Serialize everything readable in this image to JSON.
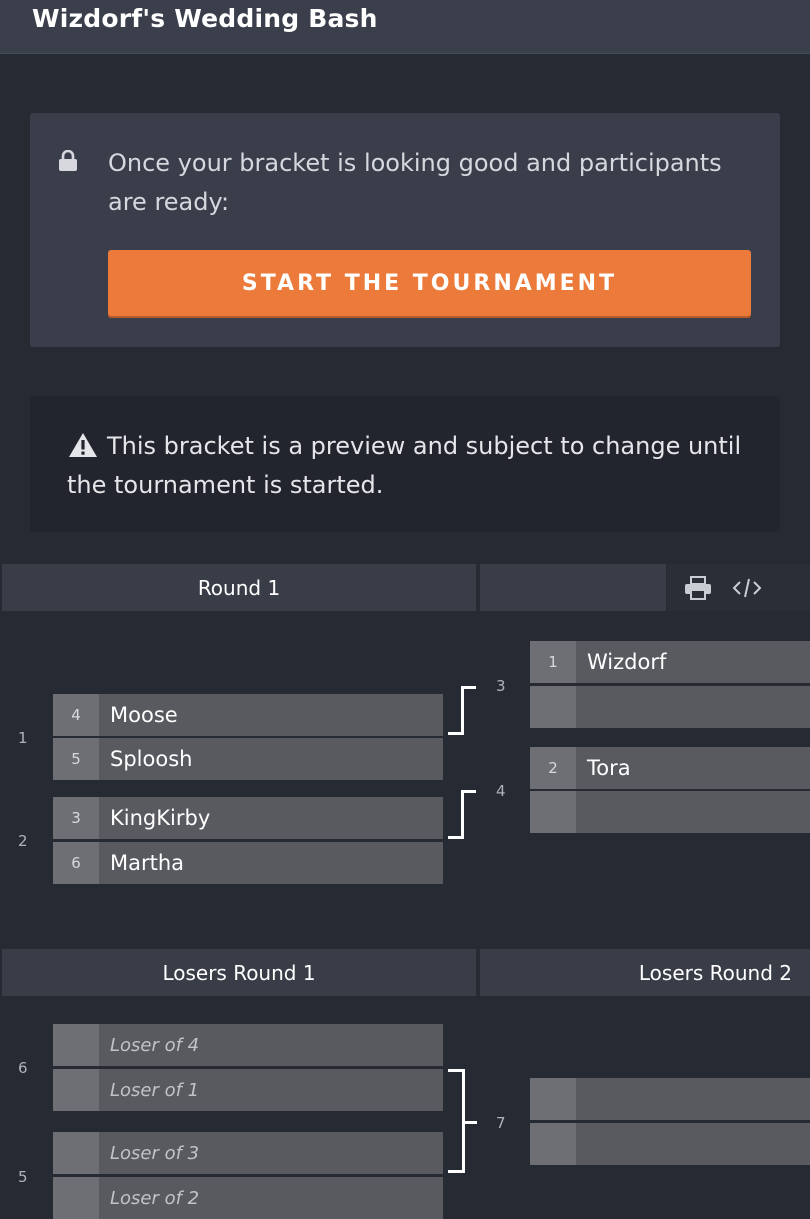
{
  "header": {
    "title": "Wizdorf's Wedding Bash"
  },
  "start_panel": {
    "message": "Once your bracket is looking good and participants are ready:",
    "button_label": "START THE TOURNAMENT",
    "lock_icon": "lock-icon",
    "button_color": "#ec7b3b"
  },
  "warning": {
    "message": "This bracket is a preview and subject to change until the tournament is started.",
    "icon": "warning-icon"
  },
  "winners_bracket": {
    "round1_label": "Round 1",
    "tools": {
      "print_icon": "print-icon",
      "embed_icon": "code-icon"
    },
    "matches": [
      {
        "number": "1",
        "slots": [
          {
            "seed": "4",
            "name": "Moose"
          },
          {
            "seed": "5",
            "name": "Sploosh"
          }
        ]
      },
      {
        "number": "2",
        "slots": [
          {
            "seed": "3",
            "name": "KingKirby"
          },
          {
            "seed": "6",
            "name": "Martha"
          }
        ]
      },
      {
        "number": "3",
        "slots": [
          {
            "seed": "1",
            "name": "Wizdorf"
          },
          {
            "seed": "",
            "name": ""
          }
        ]
      },
      {
        "number": "4",
        "slots": [
          {
            "seed": "2",
            "name": "Tora"
          },
          {
            "seed": "",
            "name": ""
          }
        ]
      }
    ]
  },
  "losers_bracket": {
    "round1_label": "Losers Round 1",
    "round2_label": "Losers Round 2",
    "matches": [
      {
        "number": "6",
        "slots": [
          {
            "seed": "",
            "name": "Loser of 4"
          },
          {
            "seed": "",
            "name": "Loser of 1"
          }
        ]
      },
      {
        "number": "5",
        "slots": [
          {
            "seed": "",
            "name": "Loser of 3"
          },
          {
            "seed": "",
            "name": "Loser of 2"
          }
        ]
      },
      {
        "number": "7",
        "slots": [
          {
            "seed": "",
            "name": ""
          },
          {
            "seed": "",
            "name": ""
          }
        ]
      }
    ]
  }
}
